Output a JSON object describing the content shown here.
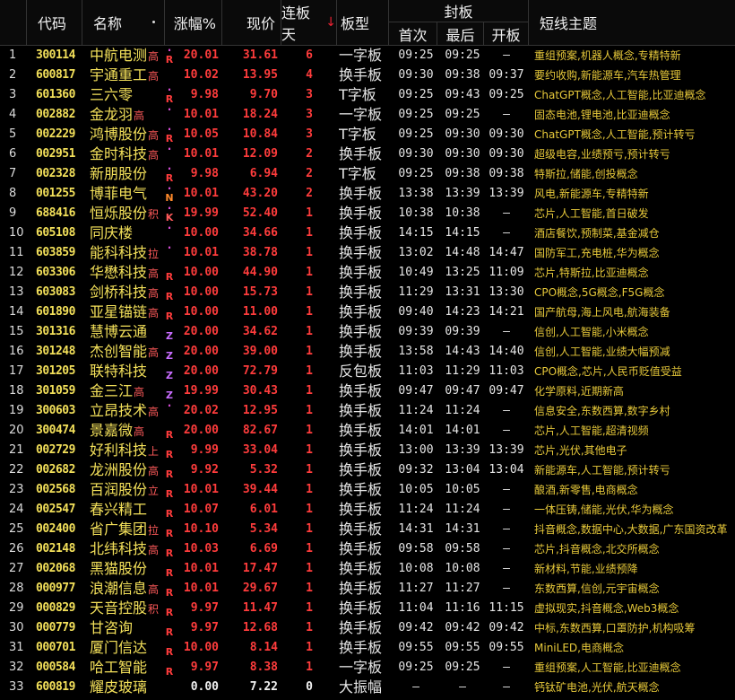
{
  "headers": {
    "code": "代码",
    "name": "名称",
    "change": "涨幅%",
    "price": "现价",
    "streak": "连板天",
    "board_type": "板型",
    "seal": "封板",
    "first": "首次",
    "last": "最后",
    "open": "开板",
    "theme": "短线主题"
  },
  "colors": {
    "up": "#ff3c3c",
    "code": "#f3e05a",
    "theme": "#e7c93a",
    "flag_dot": "#d34bd3",
    "flag_R": "#ff3c3c",
    "flag_K": "#ff5a5a",
    "flag_N": "#ff8a2a",
    "flag_Z": "#c86cff"
  },
  "rows": [
    {
      "idx": "1",
      "code": "300114",
      "name": "中航电测",
      "tag": "高",
      "dot": true,
      "flag": "R",
      "change": "20.01",
      "price": "31.61",
      "streak": "6",
      "board_type": "一字板",
      "first": "09:25",
      "last": "09:25",
      "open": "—",
      "theme": "重组预案,机器人概念,专精特新"
    },
    {
      "idx": "2",
      "code": "600817",
      "name": "宇通重工",
      "tag": "高",
      "dot": false,
      "flag": "",
      "change": "10.02",
      "price": "13.95",
      "streak": "4",
      "board_type": "换手板",
      "first": "09:30",
      "last": "09:38",
      "open": "09:37",
      "theme": "要约收购,新能源车,汽车热管理"
    },
    {
      "idx": "3",
      "code": "601360",
      "name": "三六零",
      "tag": "",
      "dot": true,
      "flag": "R",
      "change": "9.98",
      "price": "9.70",
      "streak": "3",
      "board_type": "T字板",
      "first": "09:25",
      "last": "09:43",
      "open": "09:25",
      "theme": "ChatGPT概念,人工智能,比亚迪概念"
    },
    {
      "idx": "4",
      "code": "002882",
      "name": "金龙羽",
      "tag": "高",
      "dot": true,
      "flag": "",
      "change": "10.01",
      "price": "18.24",
      "streak": "3",
      "board_type": "一字板",
      "first": "09:25",
      "last": "09:25",
      "open": "—",
      "theme": "固态电池,锂电池,比亚迪概念"
    },
    {
      "idx": "5",
      "code": "002229",
      "name": "鸿博股份",
      "tag": "高",
      "dot": true,
      "flag": "R",
      "change": "10.05",
      "price": "10.84",
      "streak": "3",
      "board_type": "T字板",
      "first": "09:25",
      "last": "09:30",
      "open": "09:30",
      "theme": "ChatGPT概念,人工智能,预计转亏"
    },
    {
      "idx": "6",
      "code": "002951",
      "name": "金时科技",
      "tag": "高",
      "dot": true,
      "flag": "",
      "change": "10.01",
      "price": "12.09",
      "streak": "2",
      "board_type": "换手板",
      "first": "09:30",
      "last": "09:30",
      "open": "09:30",
      "theme": "超级电容,业绩预亏,预计转亏"
    },
    {
      "idx": "7",
      "code": "002328",
      "name": "新朋股份",
      "tag": "",
      "dot": true,
      "flag": "R",
      "change": "9.98",
      "price": "6.94",
      "streak": "2",
      "board_type": "T字板",
      "first": "09:25",
      "last": "09:38",
      "open": "09:38",
      "theme": "特斯拉,储能,创投概念"
    },
    {
      "idx": "8",
      "code": "001255",
      "name": "博菲电气",
      "tag": "",
      "dot": true,
      "flag": "N",
      "change": "10.01",
      "price": "43.20",
      "streak": "2",
      "board_type": "换手板",
      "first": "13:38",
      "last": "13:39",
      "open": "13:39",
      "theme": "风电,新能源车,专精特新"
    },
    {
      "idx": "9",
      "code": "688416",
      "name": "恒烁股份",
      "tag": "积",
      "dot": true,
      "flag": "K",
      "change": "19.99",
      "price": "52.40",
      "streak": "1",
      "board_type": "换手板",
      "first": "10:38",
      "last": "10:38",
      "open": "—",
      "theme": "芯片,人工智能,首日破发"
    },
    {
      "idx": "10",
      "code": "605108",
      "name": "同庆楼",
      "tag": "",
      "dot": true,
      "flag": "",
      "change": "10.00",
      "price": "34.66",
      "streak": "1",
      "board_type": "换手板",
      "first": "14:15",
      "last": "14:15",
      "open": "—",
      "theme": "酒店餐饮,预制菜,基金减仓"
    },
    {
      "idx": "11",
      "code": "603859",
      "name": "能科科技",
      "tag": "拉",
      "dot": true,
      "flag": "",
      "change": "10.01",
      "price": "38.78",
      "streak": "1",
      "board_type": "换手板",
      "first": "13:02",
      "last": "14:48",
      "open": "14:47",
      "theme": "国防军工,充电桩,华为概念"
    },
    {
      "idx": "12",
      "code": "603306",
      "name": "华懋科技",
      "tag": "高",
      "dot": false,
      "flag": "R",
      "change": "10.00",
      "price": "44.90",
      "streak": "1",
      "board_type": "换手板",
      "first": "10:49",
      "last": "13:25",
      "open": "11:09",
      "theme": "芯片,特斯拉,比亚迪概念"
    },
    {
      "idx": "13",
      "code": "603083",
      "name": "剑桥科技",
      "tag": "高",
      "dot": false,
      "flag": "R",
      "change": "10.00",
      "price": "15.73",
      "streak": "1",
      "board_type": "换手板",
      "first": "11:29",
      "last": "13:31",
      "open": "13:30",
      "theme": "CPO概念,5G概念,F5G概念"
    },
    {
      "idx": "14",
      "code": "601890",
      "name": "亚星锚链",
      "tag": "高",
      "dot": false,
      "flag": "R",
      "change": "10.00",
      "price": "11.00",
      "streak": "1",
      "board_type": "换手板",
      "first": "09:40",
      "last": "14:23",
      "open": "14:21",
      "theme": "国产航母,海上风电,航海装备"
    },
    {
      "idx": "15",
      "code": "301316",
      "name": "慧博云通",
      "tag": "",
      "dot": false,
      "flag": "Z",
      "change": "20.00",
      "price": "34.62",
      "streak": "1",
      "board_type": "换手板",
      "first": "09:39",
      "last": "09:39",
      "open": "—",
      "theme": "信创,人工智能,小米概念"
    },
    {
      "idx": "16",
      "code": "301248",
      "name": "杰创智能",
      "tag": "高",
      "dot": false,
      "flag": "Z",
      "change": "20.00",
      "price": "39.00",
      "streak": "1",
      "board_type": "换手板",
      "first": "13:58",
      "last": "14:43",
      "open": "14:40",
      "theme": "信创,人工智能,业绩大幅预减"
    },
    {
      "idx": "17",
      "code": "301205",
      "name": "联特科技",
      "tag": "",
      "dot": false,
      "flag": "Z",
      "change": "20.00",
      "price": "72.79",
      "streak": "1",
      "board_type": "反包板",
      "first": "11:03",
      "last": "11:29",
      "open": "11:03",
      "theme": "CPO概念,芯片,人民币贬值受益"
    },
    {
      "idx": "18",
      "code": "301059",
      "name": "金三江",
      "tag": "高",
      "dot": false,
      "flag": "Z",
      "change": "19.99",
      "price": "30.43",
      "streak": "1",
      "board_type": "换手板",
      "first": "09:47",
      "last": "09:47",
      "open": "09:47",
      "theme": "化学原料,近期新高"
    },
    {
      "idx": "19",
      "code": "300603",
      "name": "立昂技术",
      "tag": "高",
      "dot": true,
      "flag": "",
      "change": "20.02",
      "price": "12.95",
      "streak": "1",
      "board_type": "换手板",
      "first": "11:24",
      "last": "11:24",
      "open": "—",
      "theme": "信息安全,东数西算,数字乡村"
    },
    {
      "idx": "20",
      "code": "300474",
      "name": "景嘉微",
      "tag": "高",
      "dot": false,
      "flag": "R",
      "change": "20.00",
      "price": "82.67",
      "streak": "1",
      "board_type": "换手板",
      "first": "14:01",
      "last": "14:01",
      "open": "—",
      "theme": "芯片,人工智能,超清视频"
    },
    {
      "idx": "21",
      "code": "002729",
      "name": "好利科技",
      "tag": "上",
      "dot": false,
      "flag": "R",
      "change": "9.99",
      "price": "33.04",
      "streak": "1",
      "board_type": "换手板",
      "first": "13:00",
      "last": "13:39",
      "open": "13:39",
      "theme": "芯片,光伏,其他电子"
    },
    {
      "idx": "22",
      "code": "002682",
      "name": "龙洲股份",
      "tag": "高",
      "dot": false,
      "flag": "R",
      "change": "9.92",
      "price": "5.32",
      "streak": "1",
      "board_type": "换手板",
      "first": "09:32",
      "last": "13:04",
      "open": "13:04",
      "theme": "新能源车,人工智能,预计转亏"
    },
    {
      "idx": "23",
      "code": "002568",
      "name": "百润股份",
      "tag": "立",
      "dot": false,
      "flag": "R",
      "change": "10.01",
      "price": "39.44",
      "streak": "1",
      "board_type": "换手板",
      "first": "10:05",
      "last": "10:05",
      "open": "—",
      "theme": "酿酒,新零售,电商概念"
    },
    {
      "idx": "24",
      "code": "002547",
      "name": "春兴精工",
      "tag": "",
      "dot": false,
      "flag": "R",
      "change": "10.07",
      "price": "6.01",
      "streak": "1",
      "board_type": "换手板",
      "first": "11:24",
      "last": "11:24",
      "open": "—",
      "theme": "一体压铸,储能,光伏,华为概念"
    },
    {
      "idx": "25",
      "code": "002400",
      "name": "省广集团",
      "tag": "拉",
      "dot": false,
      "flag": "R",
      "change": "10.10",
      "price": "5.34",
      "streak": "1",
      "board_type": "换手板",
      "first": "14:31",
      "last": "14:31",
      "open": "—",
      "theme": "抖音概念,数据中心,大数据,广东国资改革"
    },
    {
      "idx": "26",
      "code": "002148",
      "name": "北纬科技",
      "tag": "高",
      "dot": false,
      "flag": "R",
      "change": "10.03",
      "price": "6.69",
      "streak": "1",
      "board_type": "换手板",
      "first": "09:58",
      "last": "09:58",
      "open": "—",
      "theme": "芯片,抖音概念,北交所概念"
    },
    {
      "idx": "27",
      "code": "002068",
      "name": "黑猫股份",
      "tag": "",
      "dot": false,
      "flag": "R",
      "change": "10.01",
      "price": "17.47",
      "streak": "1",
      "board_type": "换手板",
      "first": "10:08",
      "last": "10:08",
      "open": "—",
      "theme": "新材料,节能,业绩预降"
    },
    {
      "idx": "28",
      "code": "000977",
      "name": "浪潮信息",
      "tag": "高",
      "dot": false,
      "flag": "R",
      "change": "10.01",
      "price": "29.67",
      "streak": "1",
      "board_type": "换手板",
      "first": "11:27",
      "last": "11:27",
      "open": "—",
      "theme": "东数西算,信创,元宇宙概念"
    },
    {
      "idx": "29",
      "code": "000829",
      "name": "天音控股",
      "tag": "积",
      "dot": false,
      "flag": "R",
      "change": "9.97",
      "price": "11.47",
      "streak": "1",
      "board_type": "换手板",
      "first": "11:04",
      "last": "11:16",
      "open": "11:15",
      "theme": "虚拟现实,抖音概念,Web3概念"
    },
    {
      "idx": "30",
      "code": "000779",
      "name": "甘咨询",
      "tag": "",
      "dot": false,
      "flag": "R",
      "change": "9.97",
      "price": "12.68",
      "streak": "1",
      "board_type": "换手板",
      "first": "09:42",
      "last": "09:42",
      "open": "09:42",
      "theme": "中标,东数西算,口罩防护,机构吸筹"
    },
    {
      "idx": "31",
      "code": "000701",
      "name": "厦门信达",
      "tag": "",
      "dot": false,
      "flag": "R",
      "change": "10.00",
      "price": "8.14",
      "streak": "1",
      "board_type": "换手板",
      "first": "09:55",
      "last": "09:55",
      "open": "09:55",
      "theme": "MiniLED,电商概念"
    },
    {
      "idx": "32",
      "code": "000584",
      "name": "哈工智能",
      "tag": "",
      "dot": false,
      "flag": "R",
      "change": "9.97",
      "price": "8.38",
      "streak": "1",
      "board_type": "一字板",
      "first": "09:25",
      "last": "09:25",
      "open": "—",
      "theme": "重组预案,人工智能,比亚迪概念"
    },
    {
      "idx": "33",
      "code": "600819",
      "name": "耀皮玻璃",
      "tag": "",
      "dot": false,
      "flag": "",
      "change": "0.00",
      "price": "7.22",
      "streak": "0",
      "board_type": "大振幅",
      "first": "—",
      "last": "—",
      "open": "—",
      "theme": "钙钛矿电池,光伏,航天概念"
    }
  ]
}
